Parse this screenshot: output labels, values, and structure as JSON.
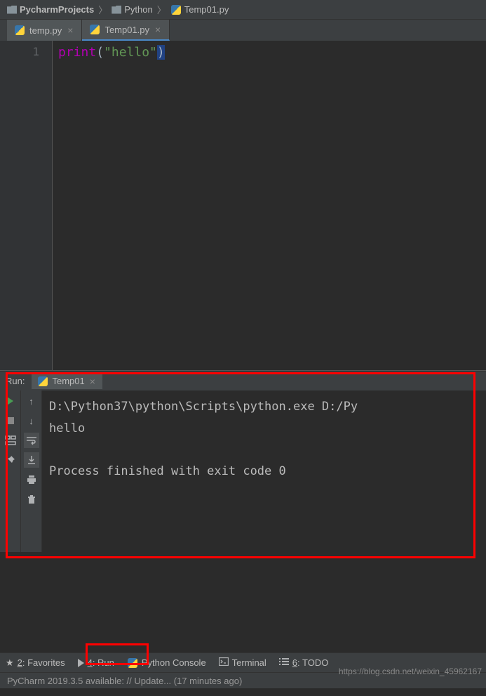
{
  "breadcrumb": {
    "root": "PycharmProjects",
    "folder": "Python",
    "file": "Temp01.py"
  },
  "tabs": [
    {
      "label": "temp.py"
    },
    {
      "label": "Temp01.py"
    }
  ],
  "editor": {
    "line_number": "1",
    "fn": "print",
    "open": "(",
    "str": "\"hello\"",
    "close": ")"
  },
  "run": {
    "header_label": "Run:",
    "tab_label": "Temp01",
    "output_line1": "D:\\Python37\\python\\Scripts\\python.exe D:/Py",
    "output_line2": "hello",
    "output_line3": "",
    "output_line4": "Process finished with exit code 0"
  },
  "bottom": {
    "favorites_num": "2",
    "favorites_label": ": Favorites",
    "run_num": "4",
    "run_label": ": Run",
    "pyconsole": "Python Console",
    "terminal": "Terminal",
    "todo_num": "6",
    "todo_label": ": TODO"
  },
  "status": {
    "text": "PyCharm 2019.3.5 available: // Update... (17 minutes ago)"
  },
  "watermark": "https://blog.csdn.net/weixin_45962167"
}
